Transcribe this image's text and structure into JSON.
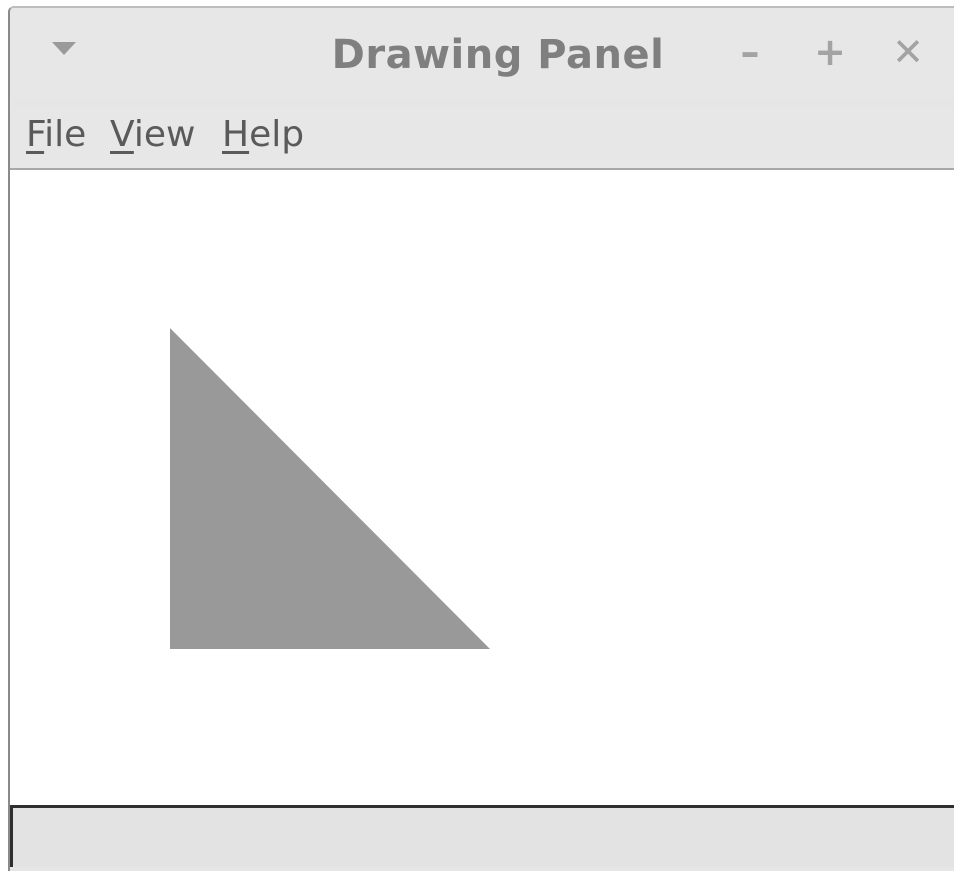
{
  "window": {
    "title": "Drawing Panel"
  },
  "titlebar": {
    "window_menu_icon": "triangle-down-icon",
    "minimize_glyph": "–",
    "maximize_glyph": "+",
    "close_glyph": "✕"
  },
  "menubar": {
    "items": [
      {
        "mnemonic": "F",
        "rest": "ile"
      },
      {
        "mnemonic": "V",
        "rest": "iew"
      },
      {
        "mnemonic": "H",
        "rest": "elp"
      }
    ]
  },
  "canvas": {
    "shape": "right-triangle",
    "fill_color": "#999999",
    "background_color": "#ffffff"
  },
  "statusbar": {
    "text": ""
  }
}
